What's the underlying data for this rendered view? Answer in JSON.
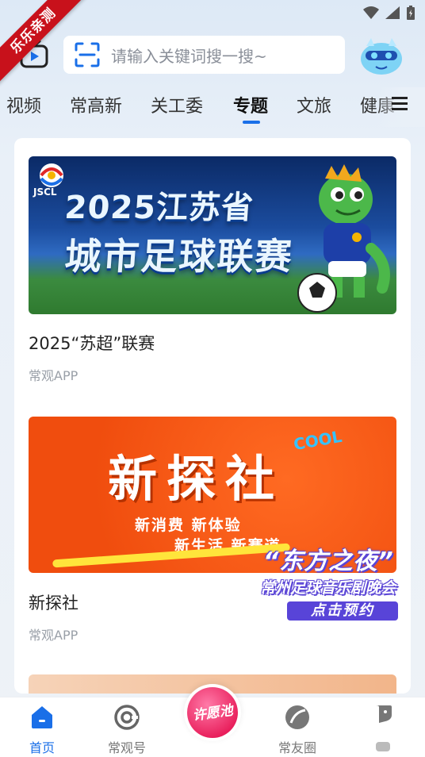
{
  "ribbon": {
    "text": "乐乐亲测"
  },
  "header": {
    "search_placeholder": "请输入关键词搜一搜~"
  },
  "tabs": [
    {
      "label": "视频"
    },
    {
      "label": "常高新"
    },
    {
      "label": "关工委"
    },
    {
      "label": "专题",
      "active": true
    },
    {
      "label": "文旅"
    },
    {
      "label": "健康"
    }
  ],
  "feed": {
    "items": [
      {
        "banner_logo": "JSCL",
        "banner_line1": "2025江苏省",
        "banner_line2": "城市足球联赛",
        "title": "2025“苏超”联赛",
        "source": "常观APP"
      },
      {
        "banner_title": "新探社",
        "banner_sub1": "新消费 新体验",
        "banner_sub2": "新生活 新赛道",
        "banner_badge": "COOL",
        "title": "新探社",
        "source": "常观APP"
      }
    ]
  },
  "promo": {
    "title": "“东方之夜”",
    "subtitle": "常州足球音乐剧晚会",
    "button": "点击预约"
  },
  "bottom_nav": {
    "items": [
      {
        "label": "首页",
        "icon": "home-icon",
        "active": true
      },
      {
        "label": "常观号",
        "icon": "channel-icon"
      },
      {
        "label": "许愿池",
        "icon": "wish-icon"
      },
      {
        "label": "常友圈",
        "icon": "circle-icon"
      },
      {
        "label": "",
        "icon": "chat-icon"
      }
    ]
  },
  "colors": {
    "accent": "#1a6fe8",
    "ribbon": "#c8111b",
    "promo": "#5844d8",
    "wish": "#e81d5a"
  }
}
